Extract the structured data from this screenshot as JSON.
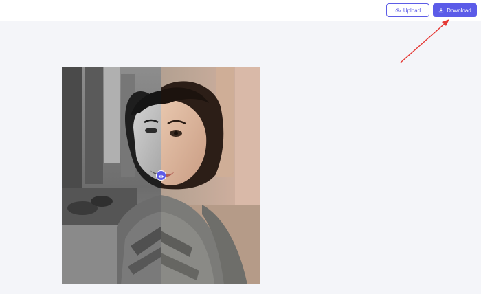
{
  "toolbar": {
    "upload_label": "Upload",
    "download_label": "Download",
    "upload_icon": "cloud-upload-icon",
    "download_icon": "download-icon"
  },
  "colors": {
    "accent": "#5b5be8",
    "background": "#f4f5f9",
    "annotation_arrow": "#e53935"
  },
  "comparison": {
    "left_version": "original-black-and-white",
    "right_version": "colorized",
    "slider_position": 0.5,
    "handle_icon": "left-right-arrows-icon"
  }
}
